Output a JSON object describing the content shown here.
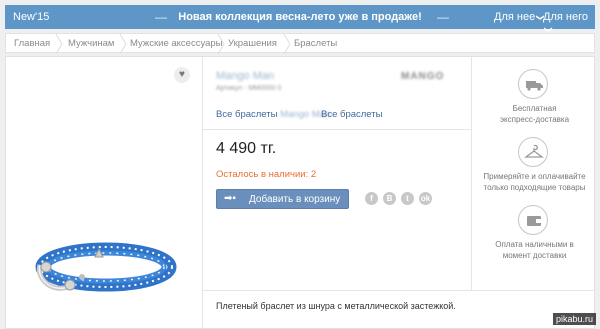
{
  "topbar": {
    "tag": "New'15",
    "promo": "Новая коллекция весна-лето уже в продаже!",
    "for_him": "Для нее",
    "for_her": "Для него"
  },
  "breadcrumbs": [
    "Главная",
    "Мужчинам",
    "Мужские аксессуары",
    "Украшения",
    "Браслеты"
  ],
  "product": {
    "brand": "Mango Man",
    "article": "Артикул - MM0000 0",
    "brand_logo": "MANGO",
    "link_brand_prefix": "Все браслеты",
    "link_brand_name": "Mango Man",
    "link_all": "Все браслеты",
    "price": "4 490 тг.",
    "stock": "Осталось в наличии: 2",
    "add_to_cart": "Добавить в корзину",
    "description": "Плетеный браслет из шнура с металлической застежкой."
  },
  "social": [
    "f",
    "B",
    "t",
    "ok"
  ],
  "perks": [
    {
      "icon": "truck-icon",
      "text_1": "Бесплатная",
      "text_2": "экспресс-доставка"
    },
    {
      "icon": "hanger-icon",
      "text_1": "Примеряйте и оплачивайте",
      "text_2": "только подходящие товары"
    },
    {
      "icon": "wallet-icon",
      "text_1": "Оплата наличными в",
      "text_2": "момент доставки"
    }
  ],
  "watermark": "pikabu.ru",
  "colors": {
    "topbar": "#5f96c8",
    "accent": "#6b8fbd",
    "stock": "#ef6c32",
    "link": "#3e6a9d"
  }
}
